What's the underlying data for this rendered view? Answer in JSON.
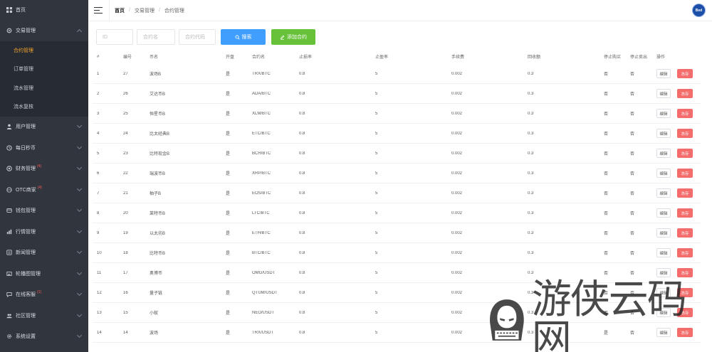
{
  "sidebar": {
    "home": "首页",
    "trade": {
      "label": "交易管理",
      "children": [
        "合约管理",
        "订单管理",
        "流水管理",
        "流水复核"
      ]
    },
    "items": [
      {
        "label": "用户管理",
        "badge": "",
        "icon": "user-icon"
      },
      {
        "label": "每日秒币",
        "badge": "",
        "icon": "clock-icon"
      },
      {
        "label": "财务管理",
        "badge": "(4)",
        "icon": "wallet-icon"
      },
      {
        "label": "OTC商家",
        "badge": "(4)",
        "icon": "globe-icon"
      },
      {
        "label": "钱包管理",
        "badge": "",
        "icon": "card-icon"
      },
      {
        "label": "行情管理",
        "badge": "",
        "icon": "chart-icon"
      },
      {
        "label": "新闻管理",
        "badge": "",
        "icon": "news-icon"
      },
      {
        "label": "轮播图管理",
        "badge": "",
        "icon": "image-icon"
      },
      {
        "label": "在线客服",
        "badge": "(1)",
        "icon": "chat-icon"
      },
      {
        "label": "社区管理",
        "badge": "",
        "icon": "community-icon"
      },
      {
        "label": "系统设置",
        "badge": "",
        "icon": "gear-icon"
      }
    ]
  },
  "header": {
    "breadcrumb": [
      "首页",
      "交易管理",
      "合约管理"
    ],
    "avatar_text": "Bed"
  },
  "toolbar": {
    "id_placeholder": "ID",
    "name_placeholder": "合约名",
    "code_placeholder": "合约代码",
    "search_label": "搜索",
    "add_label": "添加合约"
  },
  "table": {
    "headers": [
      "#",
      "编号",
      "币名",
      "开盘",
      "合约名",
      "止损率",
      "止盈率",
      "手续费",
      "回收额",
      "停止购买",
      "停止卖出",
      "操作"
    ],
    "edit_label": "编辑",
    "stop_label": "冻存",
    "rows": [
      [
        "1",
        "27",
        "波场B",
        "是",
        "TRX/BTC",
        "0.8",
        "5",
        "0.002",
        "0.3",
        "否",
        "否"
      ],
      [
        "2",
        "26",
        "艾达币B",
        "是",
        "ADA/BTC",
        "0.8",
        "5",
        "0.002",
        "0.3",
        "否",
        "否"
      ],
      [
        "3",
        "25",
        "恒星币B",
        "是",
        "XLM/BTC",
        "0.8",
        "5",
        "0.002",
        "0.3",
        "否",
        "否"
      ],
      [
        "4",
        "24",
        "比太经典B",
        "是",
        "ETC/BTC",
        "0.8",
        "5",
        "0.002",
        "0.3",
        "否",
        "否"
      ],
      [
        "5",
        "23",
        "比特现金B",
        "是",
        "BCH/BTC",
        "0.8",
        "5",
        "0.002",
        "0.3",
        "否",
        "否"
      ],
      [
        "6",
        "22",
        "瑞波币B",
        "是",
        "XRP/BTC",
        "0.8",
        "5",
        "0.002",
        "0.3",
        "否",
        "否"
      ],
      [
        "7",
        "21",
        "柚子B",
        "是",
        "EOS/BTC",
        "0.8",
        "5",
        "0.002",
        "0.3",
        "否",
        "否"
      ],
      [
        "8",
        "20",
        "莱特币B",
        "是",
        "LTC/BTC",
        "0.8",
        "5",
        "0.002",
        "0.3",
        "否",
        "否"
      ],
      [
        "9",
        "19",
        "以太坊B",
        "是",
        "ETH/BTC",
        "0.8",
        "5",
        "0.002",
        "0.3",
        "否",
        "否"
      ],
      [
        "10",
        "18",
        "比特币B",
        "是",
        "BTC/BTC",
        "0.8",
        "5",
        "0.002",
        "0.3",
        "否",
        "否"
      ],
      [
        "11",
        "17",
        "奥博币",
        "是",
        "OMG/USDT",
        "0.8",
        "5",
        "0.002",
        "0.3",
        "否",
        "否"
      ],
      [
        "12",
        "16",
        "量子链",
        "是",
        "QTUM/USDT",
        "0.8",
        "5",
        "0.002",
        "0.3",
        "否",
        "否"
      ],
      [
        "13",
        "15",
        "小蚁",
        "是",
        "NEO/USDT",
        "0.8",
        "5",
        "0.002",
        "0.3",
        "否",
        "否"
      ],
      [
        "14",
        "14",
        "波场",
        "是",
        "TRX/USDT",
        "0.8",
        "5",
        "0.002",
        "0.3",
        "是",
        "否"
      ]
    ]
  },
  "watermark": {
    "text": "游侠云码网"
  },
  "colors": {
    "sidebar_bg": "#30353e",
    "active_menu": "#f2a52e",
    "search_button": "#409eff",
    "add_button": "#67c23a",
    "stop_button": "#f56c6c"
  }
}
